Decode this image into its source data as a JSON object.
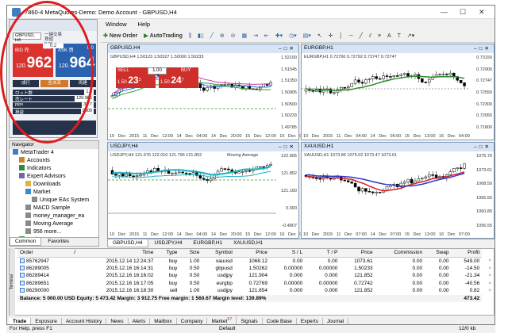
{
  "window": {
    "title": "7860-4 MetaQuotes-Demo: Demo Account - GBPUSD,H4"
  },
  "menu": [
    "Window",
    "Help"
  ],
  "toolbar": {
    "new_order": "New Order",
    "autotrading": "AutoTrading"
  },
  "oneclick_panel": {
    "symbol": "GBPUSD, H4",
    "header": "一键交易",
    "info_line1": "買値",
    "info_line2": "0.01",
    "sell_label": "BID 売",
    "sell_change": "0.0",
    "sell_prefix": "120.",
    "sell_big": "962",
    "buy_label": "ASK 買",
    "buy_change": "0.0",
    "buy_prefix": "120.",
    "buy_big": "964",
    "spread": "0.2",
    "lot_buttons": [
      "成行",
      "全決済",
      "両建"
    ],
    "rows": [
      {
        "label": "ロット数",
        "value": "1.0"
      },
      {
        "label": "売レート",
        "value": "120.965"
      },
      {
        "label": "pips",
        "value": "38.7"
      },
      {
        "label": "損益",
        "value": "2000"
      }
    ]
  },
  "navigator": {
    "header": "Navigator",
    "items": [
      {
        "label": "MetaTrader 4",
        "level": 0,
        "icon": "terminal-icon"
      },
      {
        "label": "Accounts",
        "level": 1,
        "icon": "accounts-icon"
      },
      {
        "label": "Indicators",
        "level": 1,
        "icon": "indicators-icon"
      },
      {
        "label": "Expert Advisors",
        "level": 1,
        "icon": "expert-icon"
      },
      {
        "label": "Downloads",
        "level": 2,
        "icon": "folder-icon"
      },
      {
        "label": "Market",
        "level": 2,
        "icon": "market-icon"
      },
      {
        "label": "Unique EAs System",
        "level": 3,
        "icon": "ea-icon"
      },
      {
        "label": "MACD Sample",
        "level": 2,
        "icon": "ea-icon"
      },
      {
        "label": "money_manager_ea",
        "level": 2,
        "icon": "ea-icon"
      },
      {
        "label": "Moving Average",
        "level": 2,
        "icon": "ea-icon"
      },
      {
        "label": "956 more...",
        "level": 2,
        "icon": "more-icon"
      },
      {
        "label": "Scripts",
        "level": 1,
        "icon": "scripts-icon"
      }
    ],
    "tabs": [
      "Common",
      "Favorites"
    ]
  },
  "charts": [
    {
      "title": "GBPUSD,H4",
      "info": "GBPUSD,H4  1.50123 1.50327 1.50000 1.50233",
      "yticks": [
        "1.52100",
        "1.51545",
        "1.51350",
        "1.50905",
        "1.50500",
        "1.50233",
        "1.49785"
      ],
      "xticks": "10 Dec 2015  11 Dec 12:00  14 Dec 04:00  14 Dec 20:00  15 Dec 12:00  16 Dec 04:00",
      "sell_label": "SELL",
      "buy_label": "BUY",
      "lot": "1.00",
      "sell_price_prefix": "1.50",
      "sell_price_big": "23",
      "sell_price_sup": "3",
      "buy_price_prefix": "1.50",
      "buy_price_big": "24",
      "buy_price_sup": "7",
      "order_line": "#86289005 buy 0.50"
    },
    {
      "title": "EURGBP,H1",
      "info": "EURGBP,H1  0.72760 0.72792 0.72747 0.72747",
      "yticks": [
        "0.73150",
        "0.72900",
        "0.72747",
        "0.72550",
        "0.72300",
        "0.72050",
        "0.71800"
      ],
      "xticks": "10 Dec 2015  11 Dec 04:00  14 Dec 05:00  15 Dec 13:00  16 Dec 04:00",
      "order_line": "#86289651 buy 0.50"
    },
    {
      "title": "USDJPY,H4",
      "info": "USDJPY,H4  121.976 122.016 121.796 121.852",
      "indicator": "Moving Average",
      "yticks": [
        "122.905",
        "121.852",
        "121.160",
        "0.000",
        "-0.4807"
      ],
      "xticks": "10 Dec 2015  11 Dec 12:00  14 Dec 04:00  14 Dec 20:00  15 Dec 12:00  16 Dec 04:00",
      "order_line": "#86289414 buy 0.50",
      "osc_label": "MACD(12,26,9) 0.0231 -0.0217"
    },
    {
      "title": "XAUUSD,H1",
      "info": "XAUUSD,H1  1073.86 1075.02 1073.47 1073.61",
      "yticks": [
        "1075.70",
        "1073.61",
        "1068.50",
        "1065.50",
        "1060.80",
        "1056.55"
      ],
      "xticks": "10 Dec 2015  11 Dec 07:00  14 Dec 07:00  15 Dec 13:00  16 Dec 07:00"
    }
  ],
  "chart_tabs": [
    "GBPUSD,H4",
    "USDJPY,H4",
    "EURGBP,H1",
    "XAUUSD,H1"
  ],
  "terminal": {
    "side_label": "Terminal",
    "columns": [
      "Order",
      "/",
      "Time",
      "Type",
      "Size",
      "Symbol",
      "Price",
      "S / L",
      "T / P",
      "Price",
      "Commission",
      "Swap",
      "Profit"
    ],
    "rows": [
      [
        "85762947",
        "2015.12.14 12:24:37",
        "buy",
        "1.00",
        "xauusd",
        "1068.12",
        "0.00",
        "0.00",
        "1073.61",
        "0.00",
        "0.00",
        "549.00"
      ],
      [
        "86289005",
        "2015.12.16 16:14:31",
        "buy",
        "0.50",
        "gbpusd",
        "1.50262",
        "0.00000",
        "0.00000",
        "1.50233",
        "0.00",
        "0.00",
        "-14.50"
      ],
      [
        "86289414",
        "2015.12.16 16:16:02",
        "buy",
        "0.50",
        "usdjpy",
        "121.904",
        "0.000",
        "0.000",
        "121.852",
        "0.00",
        "0.00",
        "-21.34"
      ],
      [
        "86289651",
        "2015.12.16 16:17:05",
        "buy",
        "0.50",
        "eurgbp",
        "0.72769",
        "0.00000",
        "0.00000",
        "0.72742",
        "0.00",
        "0.00",
        "-40.56"
      ],
      [
        "86290000",
        "2015.12.16 16:18:30",
        "sell",
        "1.00",
        "usdjpy",
        "121.854",
        "0.000",
        "0.000",
        "121.852",
        "0.00",
        "0.00",
        "0.82"
      ]
    ],
    "balance_line": "Balance: 5 000.00 USD  Equity: 5 473.42  Margin: 3 912.75  Free margin: 1 560.67  Margin level: 139.89%",
    "total_profit": "473.42",
    "tabs": [
      "Trade",
      "Exposure",
      "Account History",
      "News",
      "Alerts",
      "Mailbox",
      "Company",
      "Market",
      "Signals",
      "Code Base",
      "Experts",
      "Journal"
    ],
    "market_badge": "57"
  },
  "status": {
    "left": "For Help, press F1",
    "mid": "Default",
    "right": "12/0 kb"
  }
}
